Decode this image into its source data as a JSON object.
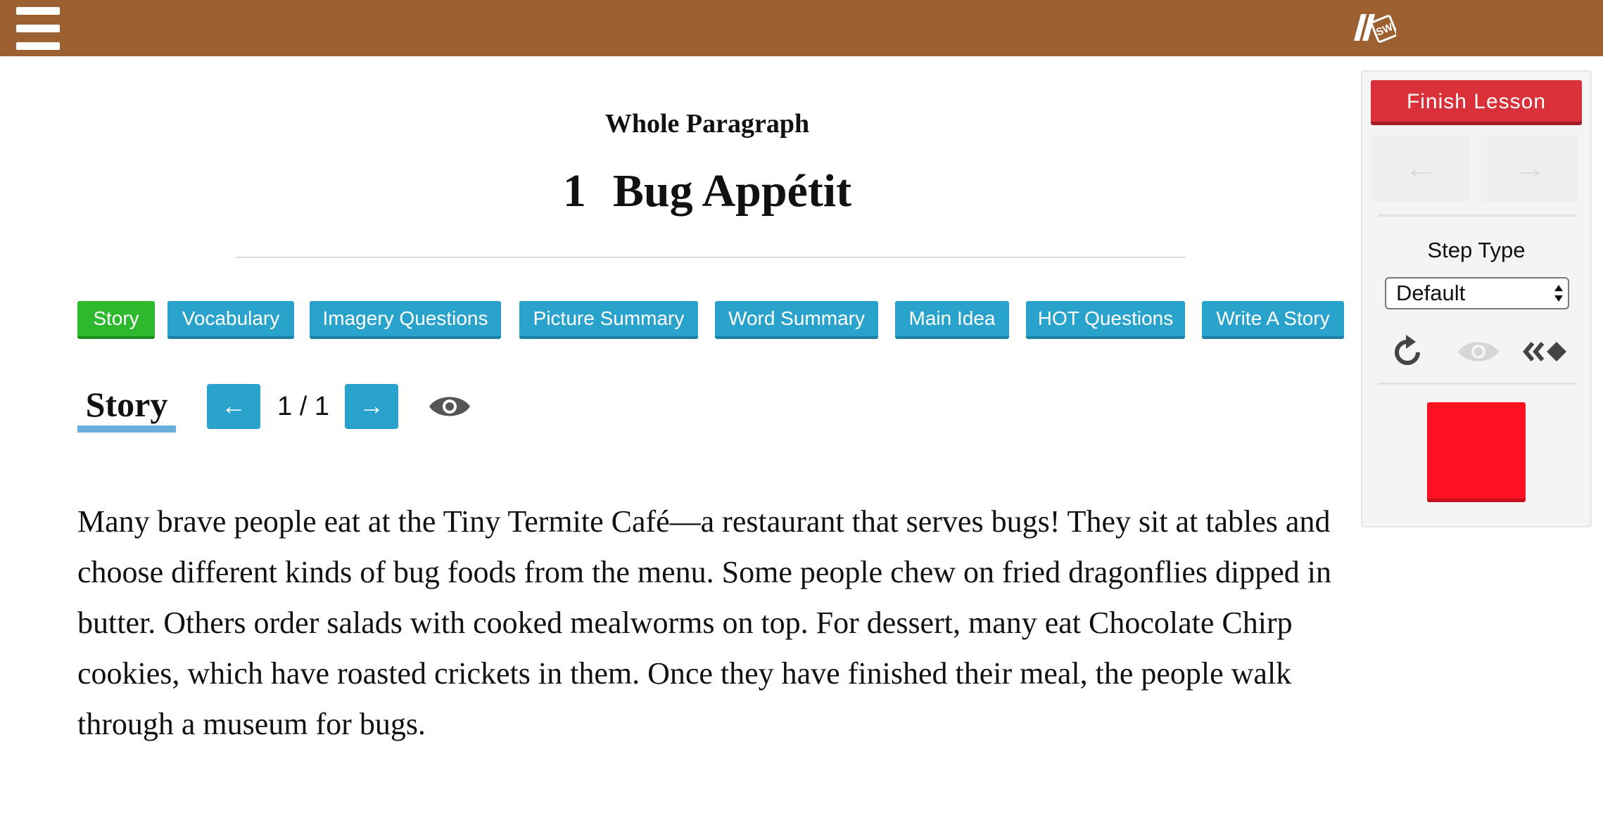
{
  "header": {
    "menu_icon": "hamburger-menu-icon",
    "logo_text": "SW",
    "color": "#9c6031"
  },
  "lesson": {
    "subtitle": "Whole Paragraph",
    "number": "1",
    "title": "Bug Appétit"
  },
  "tabs": [
    {
      "label": "Story",
      "active": true
    },
    {
      "label": "Vocabulary",
      "active": false
    },
    {
      "label": "Imagery Questions",
      "active": false
    },
    {
      "label": "Picture Summary",
      "active": false
    },
    {
      "label": "Word Summary",
      "active": false
    },
    {
      "label": "Main Idea",
      "active": false
    },
    {
      "label": "HOT Questions",
      "active": false
    },
    {
      "label": "Write A Story",
      "active": false
    }
  ],
  "story_nav": {
    "label": "Story",
    "prev_label": "←",
    "next_label": "→",
    "page_count": "1 / 1",
    "eye_icon": "eye-icon"
  },
  "story": {
    "text": "Many brave people eat at the Tiny Termite Café—a restaurant that serves bugs! They sit at tables and choose different kinds of bug foods from the menu. Some people chew on fried dragonflies dipped in butter. Others order salads with cooked mealworms on top. For dessert, many eat Chocolate Chirp cookies, which have roasted crickets in them. Once they have finished their meal, the people walk through a museum for bugs."
  },
  "panel": {
    "finish_label": "Finish Lesson",
    "prev_step_label": "←",
    "next_step_label": "→",
    "step_type_label": "Step Type",
    "step_type_value": "Default",
    "tools": [
      "reset-icon",
      "eye-icon",
      "rewind-icon"
    ],
    "colors": {
      "finish": "#d9303a",
      "square": "#ff1121",
      "tab": "#29a3cc",
      "tab_active": "#2eb82e"
    }
  }
}
